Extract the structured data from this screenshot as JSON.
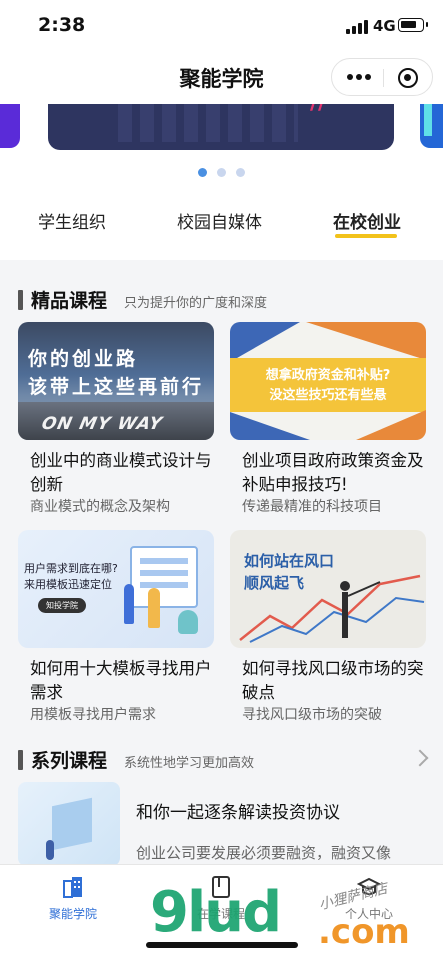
{
  "status_bar": {
    "time": "2:38",
    "network": "4G"
  },
  "nav": {
    "title": "聚能学院"
  },
  "top_tabs": [
    {
      "label": "学生组织"
    },
    {
      "label": "校园自媒体"
    },
    {
      "label": "在校创业"
    }
  ],
  "active_tab": 2,
  "banner": {
    "page_count": 3,
    "active_page": 1
  },
  "featured": {
    "title": "精品课程",
    "subtitle": "只为提升你的广度和深度",
    "courses": [
      {
        "title": "创业中的商业模式设计与创新",
        "desc": "商业模式的概念及架构",
        "thumb_text": [
          "你的创业路",
          "该带上这些再前行",
          "ON MY WAY"
        ]
      },
      {
        "title": "创业项目政府政策资金及补贴申报技巧!",
        "desc": "传递最精准的科技项目",
        "thumb_text": [
          "想拿政府资金和补贴?",
          "没这些技巧还有些悬"
        ]
      },
      {
        "title": "如何用十大模板寻找用户需求",
        "desc": "用模板寻找用户需求",
        "thumb_text": [
          "用户需求到底在哪?",
          "来用模板迅速定位",
          "知投学院"
        ]
      },
      {
        "title": "如何寻找风口级市场的突破点",
        "desc": "寻找风口级市场的突破",
        "thumb_text": [
          "如何站在风口",
          "顺风起飞"
        ]
      }
    ]
  },
  "series": {
    "title": "系列课程",
    "subtitle": "系统性地学习更加高效",
    "items": [
      {
        "title": "和你一起逐条解读投资协议",
        "desc": "创业公司要发展必须要融资，融资又像"
      }
    ]
  },
  "tab_bar": [
    {
      "label": "聚能学院",
      "icon": "building-icon"
    },
    {
      "label": "在学课程",
      "icon": "book-icon"
    },
    {
      "label": "个人中心",
      "icon": "graduation-cap-icon"
    }
  ],
  "watermark": {
    "logo": "9lud",
    "domain": ".com",
    "shop": "小狸萨商店"
  },
  "colors": {
    "accent": "#f2c21a",
    "tab_active": "#2f6fd6"
  }
}
